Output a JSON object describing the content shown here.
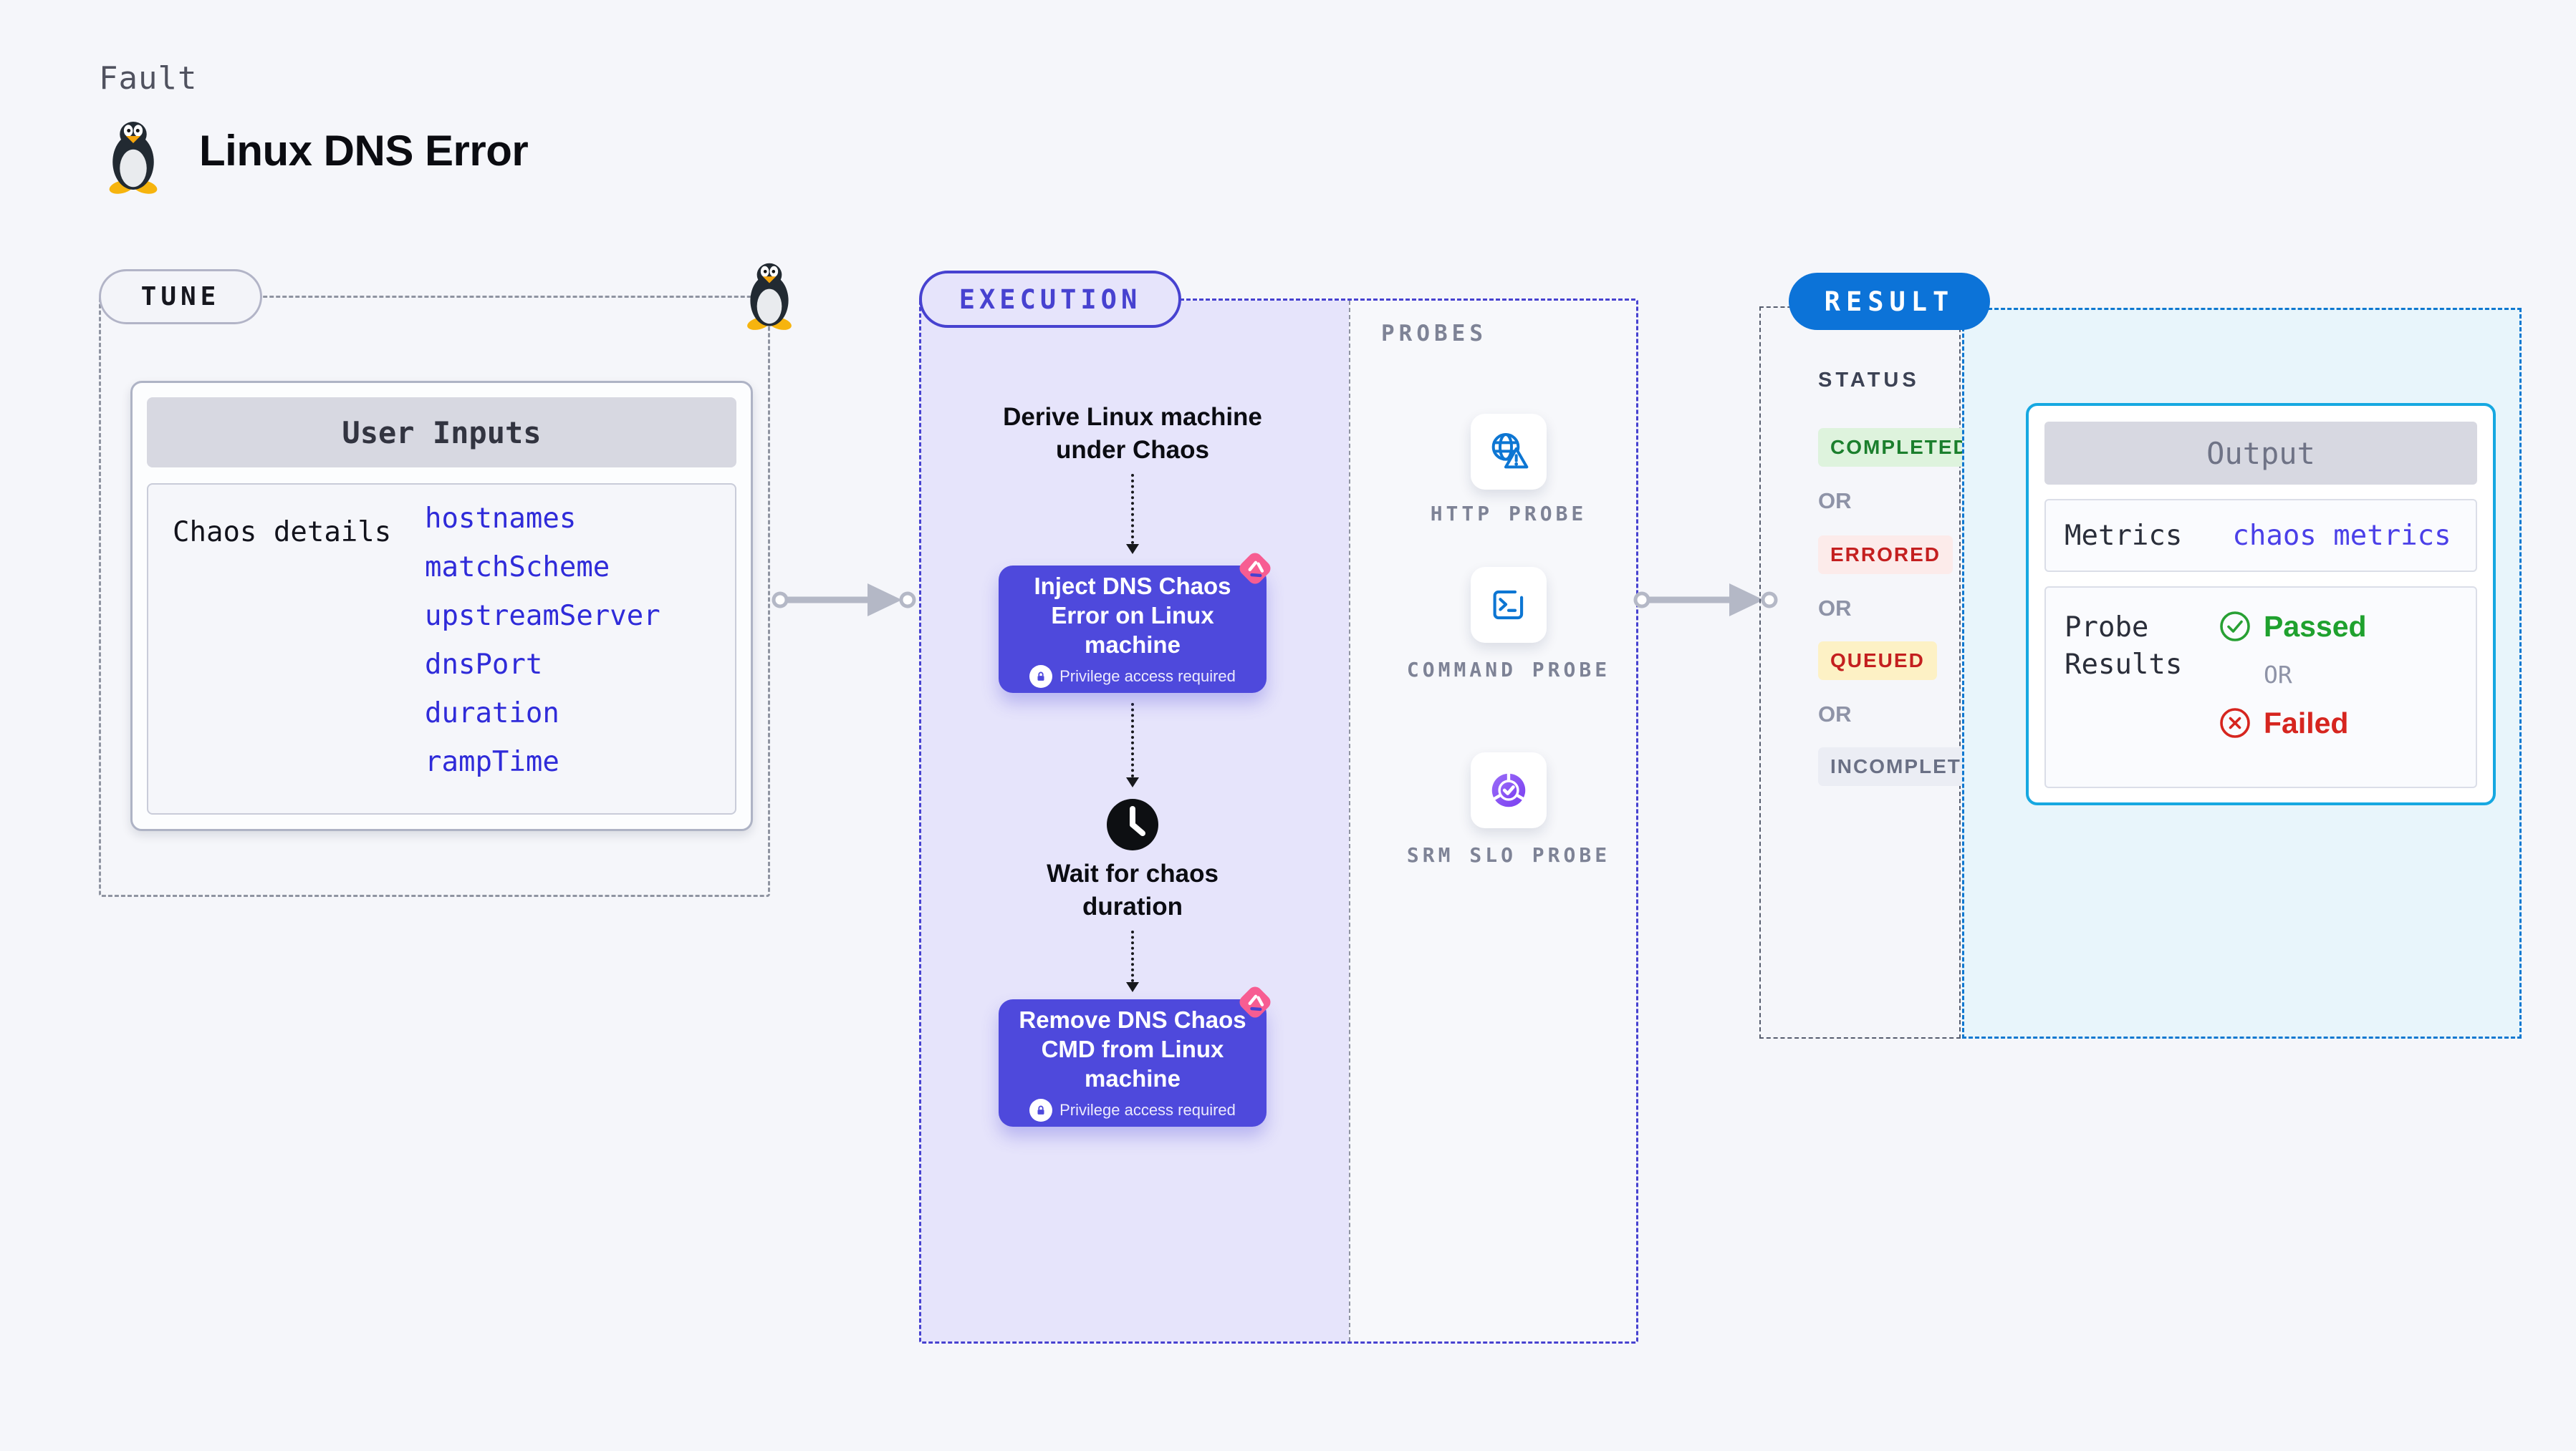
{
  "header": {
    "kind": "Fault",
    "title": "Linux DNS Error"
  },
  "tune": {
    "label": "TUNE",
    "card_title": "User Inputs",
    "row_label": "Chaos details",
    "inputs": [
      "hostnames",
      "matchScheme",
      "upstreamServer",
      "dnsPort",
      "duration",
      "rampTime"
    ]
  },
  "execution": {
    "label": "EXECUTION",
    "derive_text": "Derive Linux machine under Chaos",
    "inject_title": "Inject DNS Chaos Error on Linux machine",
    "privilege_badge": "Privilege access required",
    "wait_text": "Wait for chaos duration",
    "remove_title": "Remove DNS Chaos CMD from Linux machine"
  },
  "probes": {
    "label": "PROBES",
    "items": [
      "HTTP PROBE",
      "COMMAND PROBE",
      "SRM SLO PROBE"
    ]
  },
  "result": {
    "label": "RESULT",
    "status_label": "STATUS",
    "or": "OR",
    "statuses": [
      "COMPLETED",
      "ERRORED",
      "QUEUED",
      "INCOMPLETED"
    ],
    "output": {
      "title": "Output",
      "metrics_label": "Metrics",
      "metrics_value": "chaos metrics",
      "probe_results_label": "Probe Results",
      "passed": "Passed",
      "or": "OR",
      "failed": "Failed"
    }
  },
  "colors": {
    "accent_indigo": "#4742d0",
    "node_indigo": "#4e49dc",
    "result_blue": "#0c73d8",
    "output_cyan": "#16a8e1",
    "probe_blue": "#0d76d3",
    "chaos_pink": "#f75d92",
    "passed_green": "#1fa12e",
    "failed_red": "#d6251f"
  }
}
